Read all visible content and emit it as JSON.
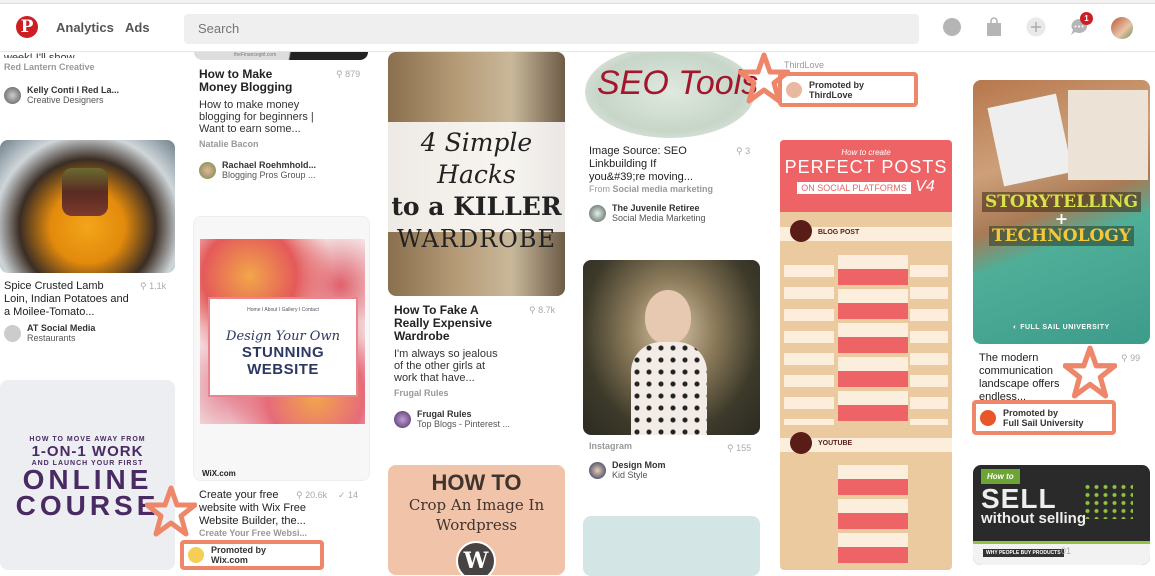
{
  "header": {
    "logo": "P",
    "nav": [
      "Analytics",
      "Ads"
    ],
    "search_placeholder": "Search",
    "icons": [
      "compass-icon",
      "shopping-bag-icon",
      "plus-icon",
      "messages-icon",
      "profile-avatar"
    ],
    "notification_count": "1"
  },
  "colors": {
    "brand": "#cb1f24",
    "highlight": "#ee8669"
  },
  "pins": {
    "col1_top": {
      "desc_clipped": "week! I'll show...",
      "source": "Red Lantern Creative",
      "user": "Kelly Conti I Red La...",
      "board": "Creative Designers"
    },
    "lamb": {
      "title": "Spice Crusted Lamb Loin, Indian Potatoes and a Moilee-Tomato...",
      "count": "1.1k",
      "user": "AT Social Media",
      "board": "Restaurants"
    },
    "course": {
      "image_lines": [
        "HOW TO MOVE AWAY FROM",
        "1-ON-1 WORK",
        "AND LAUNCH YOUR FIRST",
        "ONLINE",
        "COURSE"
      ]
    },
    "blogging": {
      "image_caption": "theFinancegirl.com",
      "title": "How to Make Money Blogging",
      "count": "879",
      "desc": "How to make money blogging for beginners | Want to earn some...",
      "source": "Natalie Bacon",
      "user": "Rachael Roehmhold...",
      "board": "Blogging Pros Group ..."
    },
    "wix": {
      "image_nav": "Home  I About  I  Gallery  I  Contact",
      "image_script": "Design Your Own",
      "image_headline": "STUNNING WEBSITE",
      "image_brand": "WiX.com",
      "title": "Create your free website with Wix Free Website Builder, the...",
      "count": "20.6k",
      "saves": "14",
      "source": "Create Your Free Websi...",
      "promoted_line1": "Promoted by",
      "promoted_line2": "Wix.com"
    },
    "wardrobe": {
      "image_lines": [
        "4 Simple Hacks",
        "to a KILLER",
        "WARDROBE"
      ],
      "title": "How To Fake A Really Expensive Wardrobe",
      "count": "8.7k",
      "desc": "I'm always so jealous of the other girls at work that have...",
      "source": "Frugal Rules",
      "user": "Frugal Rules",
      "board": "Top Blogs - Pinterest ..."
    },
    "wordpress": {
      "image_lines": [
        "HOW TO",
        "Crop An Image In",
        "Wordpress"
      ]
    },
    "seo": {
      "image_headline": "SEO Tools",
      "title": "Image Source: SEO Linkbuilding If you&#39;re moving...",
      "count": "3",
      "source_prefix": "From",
      "source": "Social media marketing",
      "user": "The Juvenile Retiree",
      "board": "Social Media Marketing"
    },
    "girl": {
      "source": "Instagram",
      "count": "155",
      "user": "Design Mom",
      "board": "Kid Style"
    },
    "thirdlove": {
      "source": "ThirdLove",
      "promoted_line1": "Promoted by",
      "promoted_line2": "ThirdLove"
    },
    "infographic": {
      "image_script": "How to create",
      "image_headline": "PERFECT POSTS",
      "image_sub": "ON SOCIAL PLATFORMS",
      "image_version": "V4",
      "section1": "BLOG POST",
      "section2": "YOUTUBE"
    },
    "fullsail": {
      "image_line1": "STORYTELLING",
      "image_plus": "+",
      "image_line2": "TECHNOLOGY",
      "image_brand": "FULL SAIL UNIVERSITY",
      "title": "The modern communication landscape offers endless...",
      "count": "99",
      "promoted_line1": "Promoted by",
      "promoted_line2": "Full Sail University"
    },
    "sell": {
      "image_tag": "How to",
      "image_headline": "SELL",
      "image_sub": "without selling",
      "image_footer": "WHY PEOPLE BUY PRODUCTS",
      "image_num": "01"
    }
  }
}
